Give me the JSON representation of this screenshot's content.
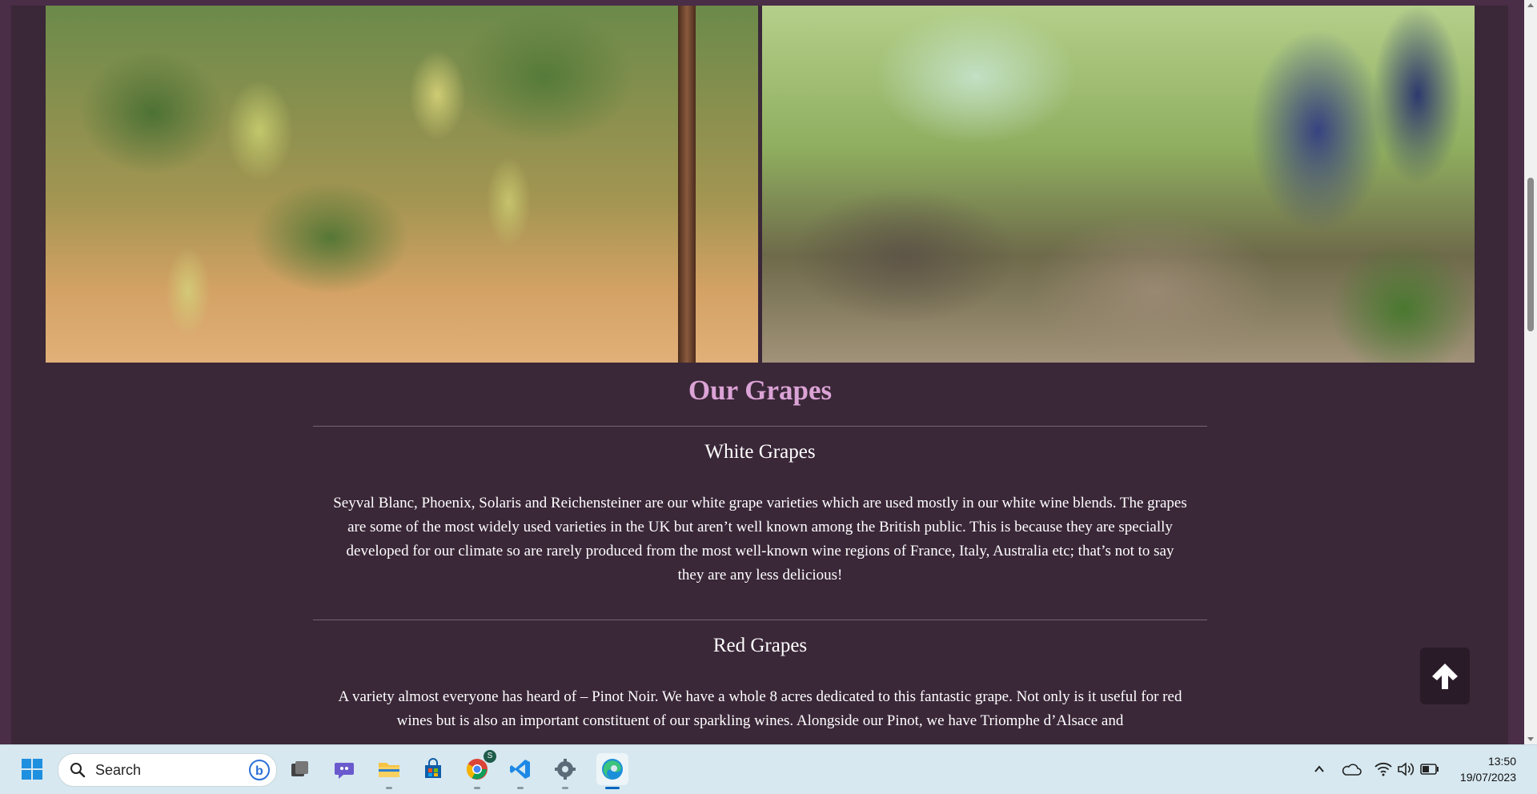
{
  "section": {
    "title": "Our Grapes"
  },
  "grapes": [
    {
      "heading": "White Grapes",
      "text": "Seyval Blanc, Phoenix, Solaris and Reichensteiner are our white grape varieties which are used mostly in our white wine blends. The grapes are some of the most widely used varieties in the UK but aren’t well known among the British public. This is because they are specially developed for our climate so are rarely produced from the most well-known wine regions of France, Italy, Australia etc; that’s not to say they are any less delicious!"
    },
    {
      "heading": "Red Grapes",
      "text": "A variety almost everyone has heard of – Pinot Noir. We have a whole 8 acres dedicated to this fantastic grape. Not only is it useful for red wines but is also an important constituent of our sparkling wines. Alongside our Pinot, we have Triomphe d’Alsace and"
    }
  ],
  "colors": {
    "background": "#3a2738",
    "accent": "#dba3d6",
    "text": "#ffffff"
  },
  "icons": {
    "scroll_top": "arrow-up-icon"
  },
  "taskbar": {
    "search_placeholder": "Search",
    "time": "13:50",
    "date": "19/07/2023",
    "chrome_badge": "S"
  }
}
